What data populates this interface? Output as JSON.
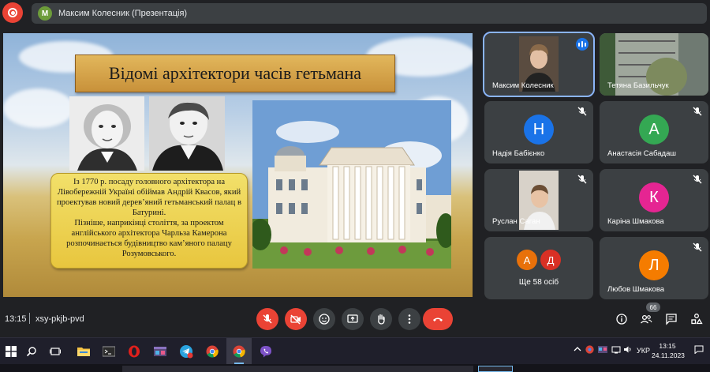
{
  "top_bar": {
    "presenter_initial": "М",
    "presenter_label": "Максим Колесник (Презентація)"
  },
  "slide": {
    "title": "Відомі архітектори часів гетьмана",
    "paragraphs": [
      "Із 1770 р. посаду головного архітектора на Лівобережній Україні обіймав Андрій Квасов, який проектував новий дерев’яний гетьманський палац в Батурині.",
      "Пізніше, наприкінці століття, за проектом англійського архітектора Чарльза Камерона розпочинається будівництво кам’яного палацу Розумовського."
    ]
  },
  "participants": [
    {
      "name": "Максим Колесник",
      "type": "video",
      "speaking": true
    },
    {
      "name": "Тетяна Базильчук",
      "type": "video"
    },
    {
      "name": "Надія Бабієнко",
      "initial": "Н",
      "color": "#1a73e8",
      "muted": true
    },
    {
      "name": "Анастасія Сабадаш",
      "initial": "А",
      "color": "#34a853",
      "muted": true
    },
    {
      "name": "Руслан Саган",
      "type": "video",
      "muted": true
    },
    {
      "name": "Каріна Шмакова",
      "initial": "К",
      "color": "#e52592",
      "muted": true
    },
    {
      "name": "Любов Шмакова",
      "initial": "Л",
      "color": "#f57c00",
      "muted": true
    }
  ],
  "others_tile": {
    "initials": [
      "А",
      "Д"
    ],
    "colors": [
      "#e8710a",
      "#d93025"
    ],
    "label": "Ще 58 осіб"
  },
  "controls": {
    "time": "13:15",
    "meeting_code": "xsy-pkjb-pvd",
    "participant_count": "66",
    "buttons": [
      "mic-off",
      "camera-off",
      "emoji",
      "present",
      "raise-hand",
      "more",
      "leave"
    ],
    "right_buttons": [
      "info",
      "people",
      "chat",
      "activities"
    ]
  },
  "taskbar": {
    "language": "УКР",
    "time": "13:15",
    "date": "24.11.2023",
    "apps": [
      "start",
      "search",
      "task-view",
      "file-explorer",
      "terminal",
      "opera",
      "app-window",
      "telegram",
      "chrome",
      "chrome-active",
      "viber"
    ]
  }
}
